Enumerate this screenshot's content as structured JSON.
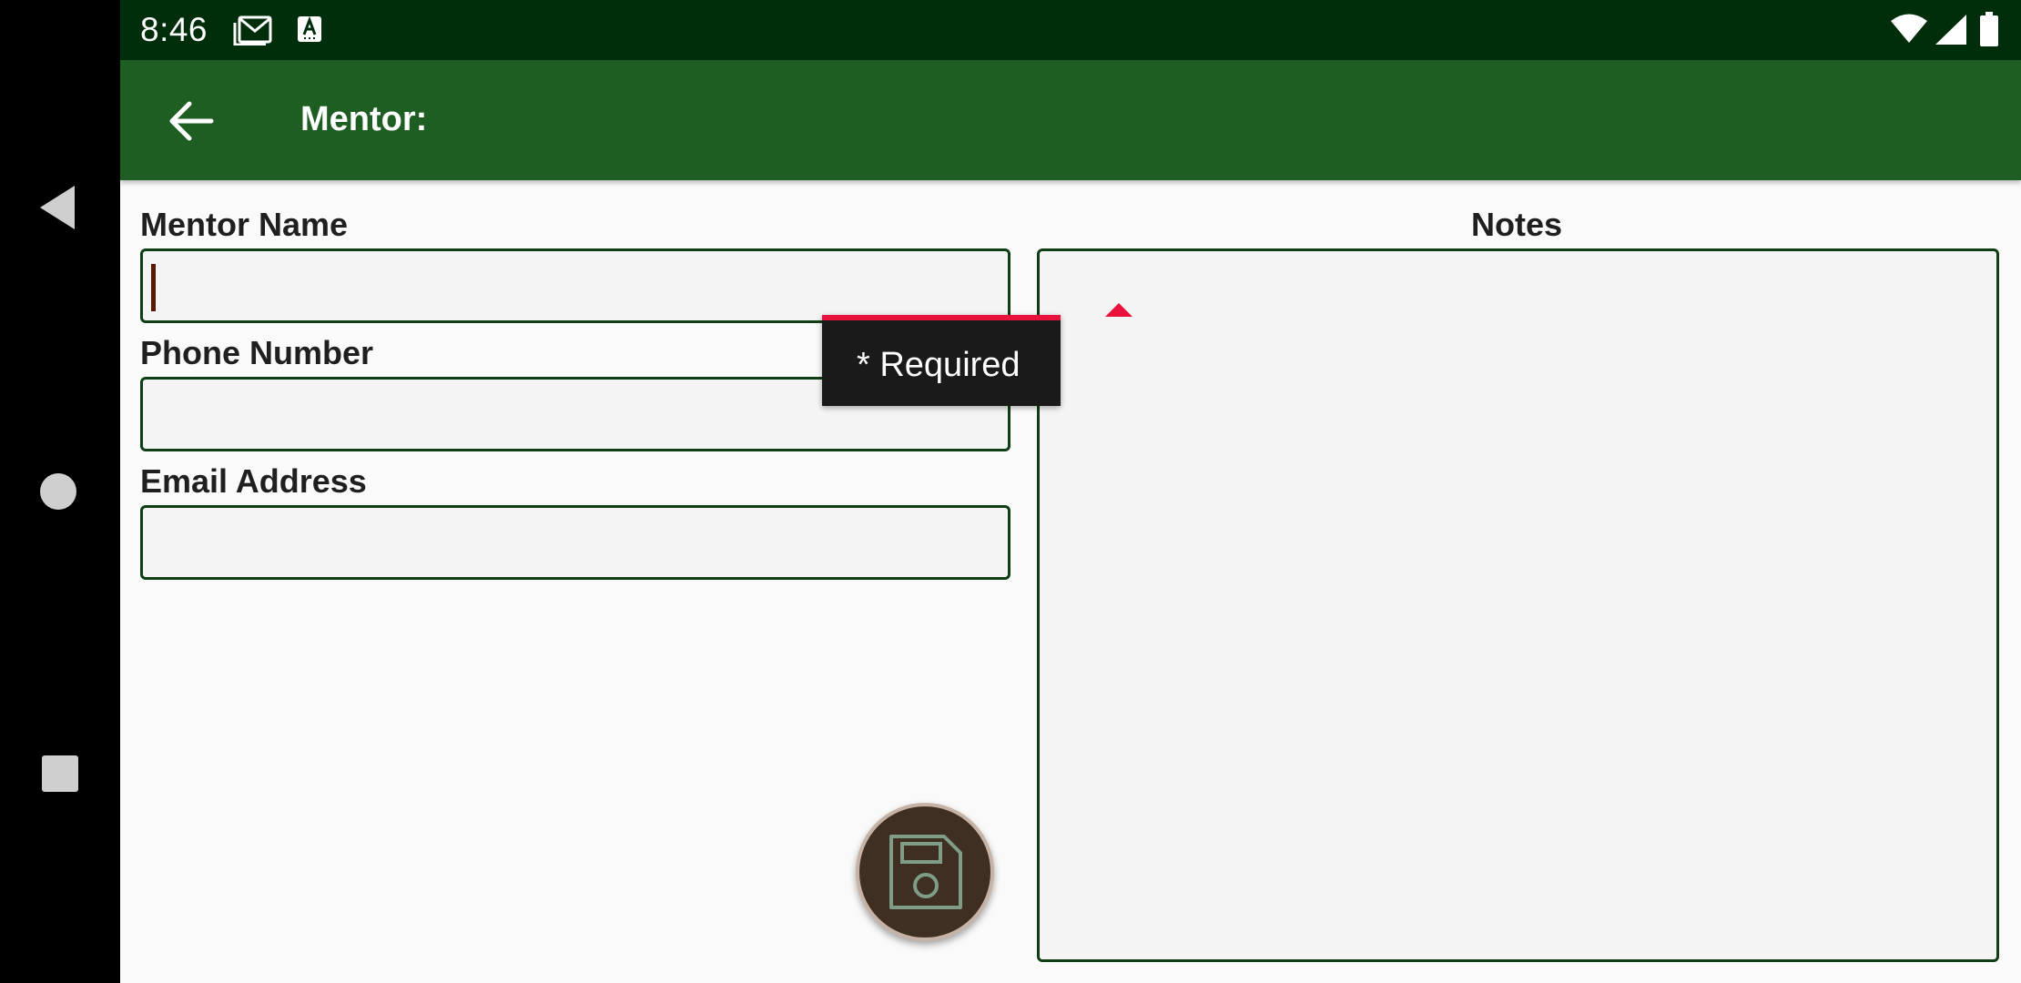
{
  "status_bar": {
    "time": "8:46",
    "icons": [
      "gmail-icon",
      "a-icon",
      "wifi-icon",
      "signal-icon",
      "battery-icon"
    ]
  },
  "app_bar": {
    "title": "Mentor:",
    "back_icon": "arrow-back-icon"
  },
  "form": {
    "mentor_name": {
      "label": "Mentor Name",
      "value": ""
    },
    "phone_number": {
      "label": "Phone Number",
      "value": ""
    },
    "email_address": {
      "label": "Email Address",
      "value": ""
    },
    "notes": {
      "label": "Notes",
      "value": ""
    }
  },
  "tooltip": {
    "text": "* Required"
  },
  "fab": {
    "icon": "save-icon"
  },
  "colors": {
    "status_bar": "#002e0b",
    "app_bar": "#1e5e22",
    "field_border": "#0f3d14",
    "error_accent": "#e8123c",
    "fab_fill": "#3e2f22"
  },
  "system_nav": {
    "icons": [
      "nav-back-icon",
      "nav-home-icon",
      "nav-recents-icon"
    ]
  }
}
